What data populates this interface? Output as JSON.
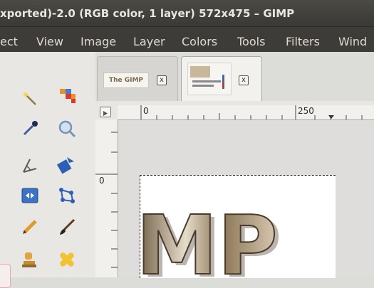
{
  "window": {
    "title": "xported)-2.0 (RGB color, 1 layer) 572x475 – GIMP"
  },
  "menubar": {
    "items": [
      "ect",
      "View",
      "Image",
      "Layer",
      "Colors",
      "Tools",
      "Filters",
      "Wind"
    ]
  },
  "tabs": [
    {
      "thumb_label": "The GIMP",
      "close": "x"
    },
    {
      "close": "x"
    }
  ],
  "rulers": {
    "h_labels": [
      "0",
      "250"
    ],
    "v_labels": [
      "0"
    ]
  },
  "image": {
    "logo_text": "MP"
  },
  "tools": [
    {
      "icon": "fuzzy-select-icon"
    },
    {
      "icon": "by-color-select-icon"
    },
    {
      "icon": "color-picker-icon"
    },
    {
      "icon": "zoom-icon"
    },
    {
      "icon": "measure-icon"
    },
    {
      "icon": "move-icon"
    },
    {
      "icon": "align-icon"
    },
    {
      "icon": "transform-icon"
    },
    {
      "icon": "pencil-icon"
    },
    {
      "icon": "paintbrush-icon"
    },
    {
      "icon": "clone-icon"
    },
    {
      "icon": "heal-icon"
    }
  ]
}
